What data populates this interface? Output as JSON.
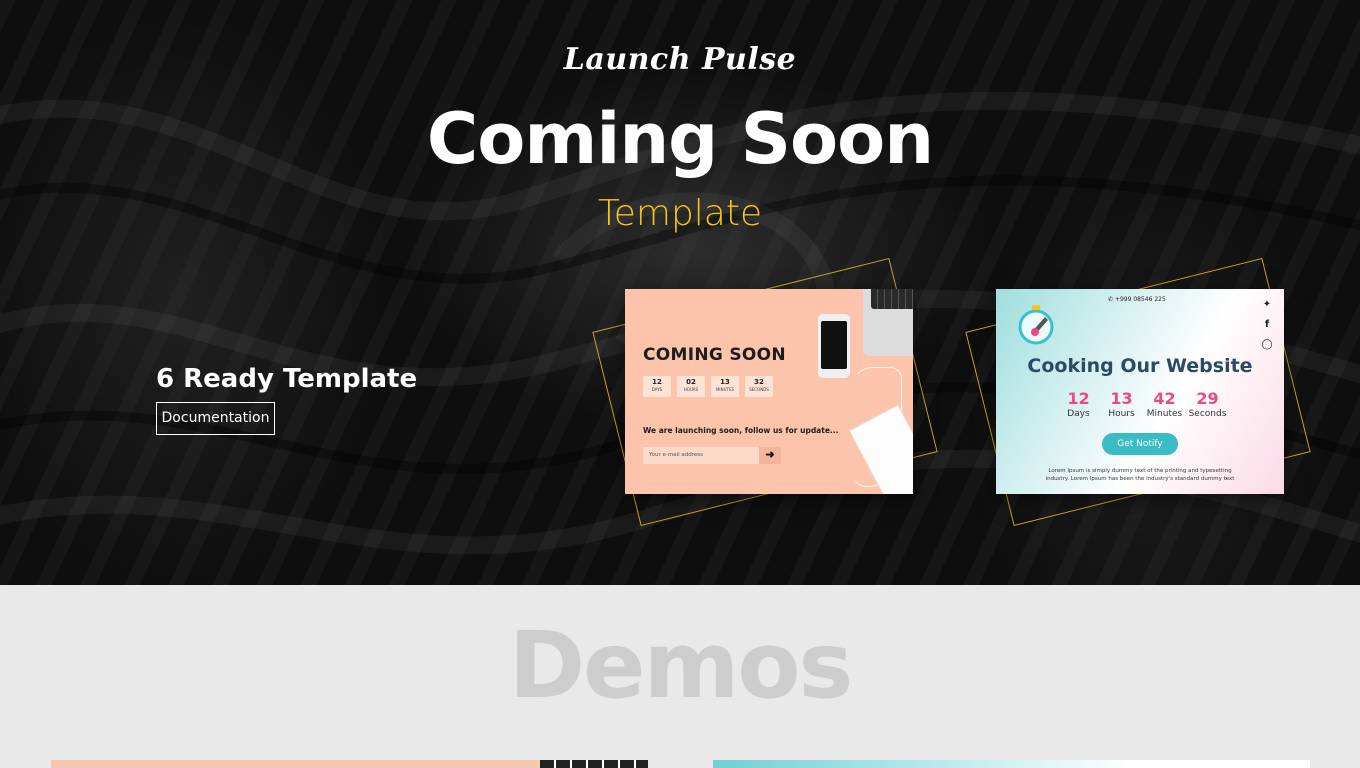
{
  "hero": {
    "brand": "Launch Pulse",
    "title": "Coming Soon",
    "subtitle": "Template",
    "ready_text": "6 Ready Template",
    "doc_button": "Documentation"
  },
  "preview1": {
    "title": "COMING SOON",
    "counters": [
      {
        "value": "12",
        "label": "DAYS"
      },
      {
        "value": "02",
        "label": "HOURS"
      },
      {
        "value": "13",
        "label": "MINUTES"
      },
      {
        "value": "32",
        "label": "SECONDS"
      }
    ],
    "message": "We are launching soon, follow us for update...",
    "email_placeholder": "Your e-mail address",
    "submit_icon": "arrow-right-icon"
  },
  "preview2": {
    "phone": "+999 08546 225",
    "title": "Cooking Our Website",
    "counters": [
      {
        "value": "12",
        "label": "Days"
      },
      {
        "value": "13",
        "label": "Hours"
      },
      {
        "value": "42",
        "label": "Minutes"
      },
      {
        "value": "29",
        "label": "Seconds"
      }
    ],
    "button": "Get Notify",
    "lorem": "Lorem Ipsum is simply dummy text of the printing and typesetting industry. Lorem Ipsum has been the industry's standard dummy text",
    "social_icons": [
      "twitter-icon",
      "facebook-icon",
      "dribbble-icon"
    ]
  },
  "demos": {
    "title": "Demos"
  },
  "colors": {
    "accent_yellow": "#f5c518",
    "gold_frame": "#c9a232",
    "peach": "#fbc4ab",
    "pink_counter": "#ec4a86",
    "teal_button": "#3bbcc4"
  }
}
